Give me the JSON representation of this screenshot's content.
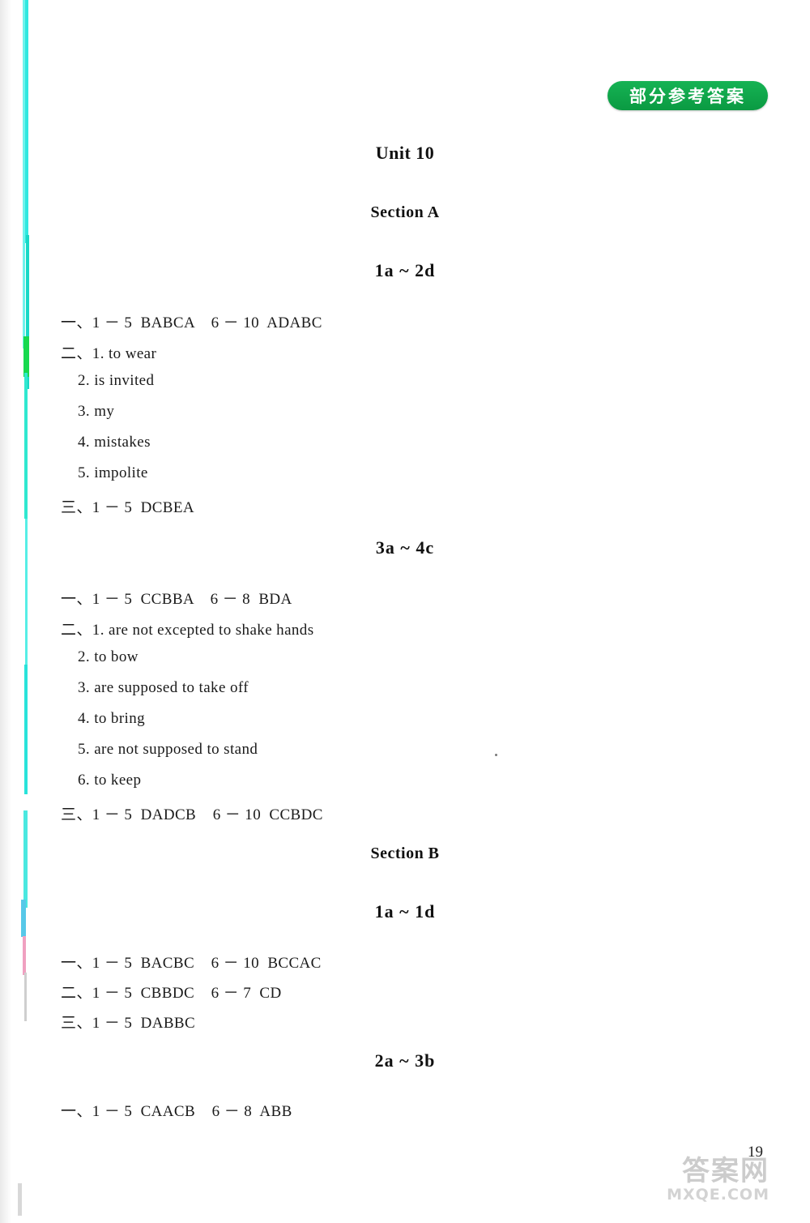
{
  "header": {
    "badge_label": "部分参考答案",
    "badge_color": "#0fa64b"
  },
  "document": {
    "unit_title": "Unit 10",
    "sections": [
      {
        "section_label": "Section A",
        "groups": [
          {
            "sub_title": "1a ~ 2d",
            "lines": [
              "一、1 － 5  BABCA    6 － 10  ADABC",
              "二、1. to wear",
              "2. is invited",
              "3. my",
              "4. mistakes",
              "5. impolite",
              "三、1 － 5  DCBEA"
            ]
          },
          {
            "sub_title": "3a ~ 4c",
            "lines": [
              "一、1 － 5  CCBBA    6 － 8  BDA",
              "二、1. are not excepted to shake hands",
              "2. to bow",
              "3. are supposed to take off",
              "4. to bring",
              "5. are not supposed to stand",
              "6. to keep",
              "三、1 － 5  DADCB    6 － 10  CCBDC"
            ]
          }
        ]
      },
      {
        "section_label": "Section B",
        "groups": [
          {
            "sub_title": "1a ~ 1d",
            "lines": [
              "一、1 － 5  BACBC    6 － 10  BCCAC",
              "二、1 － 5  CBBDC    6 － 7  CD",
              "三、1 － 5  DABBC"
            ]
          },
          {
            "sub_title": "2a ~ 3b",
            "lines": [
              "一、1 － 5  CAACB    6 － 8  ABB"
            ]
          }
        ]
      }
    ]
  },
  "footer": {
    "page_number": "19",
    "watermark_cn": "答案网",
    "watermark_en": "MXQE.COM"
  }
}
